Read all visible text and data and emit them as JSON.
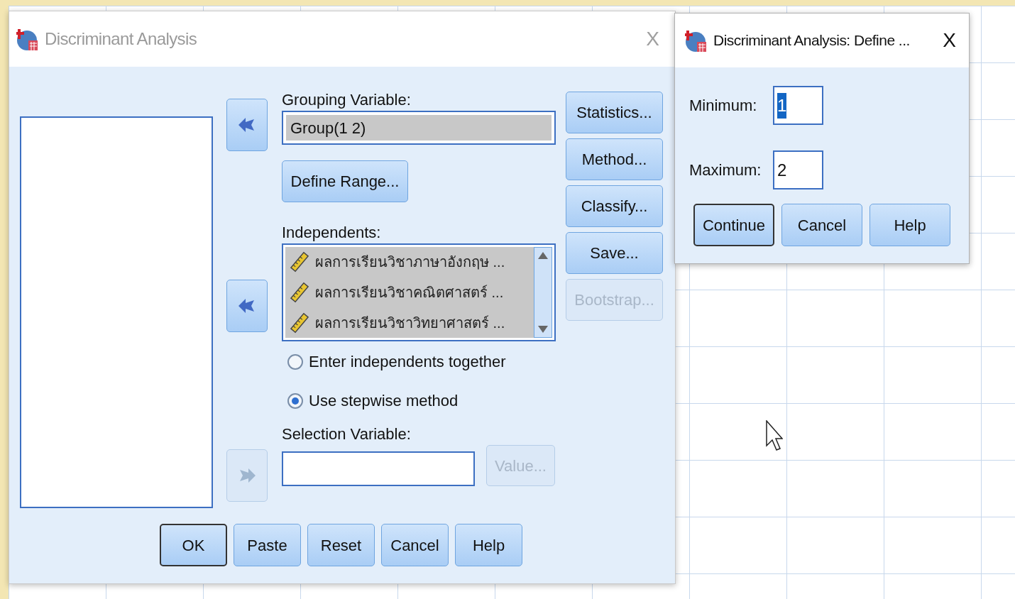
{
  "main_dialog": {
    "title": "Discriminant Analysis",
    "close": "X",
    "grouping_variable": {
      "label": "Grouping Variable:",
      "value": "Group(1 2)"
    },
    "define_range_button": {
      "label": "Define Range...",
      "disabled": false
    },
    "independents": {
      "label": "Independents:",
      "items": [
        {
          "label": "ผลการเรียนวิชาภาษาอังกฤษ ..."
        },
        {
          "label": "ผลการเรียนวิชาคณิตศาสตร์ ..."
        },
        {
          "label": "ผลการเรียนวิชาวิทยาศาสตร์ ..."
        }
      ]
    },
    "arrow_buttons": [
      {
        "kind": "left",
        "disabled": false
      },
      {
        "kind": "left",
        "disabled": false
      },
      {
        "kind": "right",
        "disabled": true
      }
    ],
    "method_options": [
      {
        "label": "Enter independents together",
        "selected": false
      },
      {
        "label": "Use stepwise method",
        "selected": true
      }
    ],
    "selection_variable": {
      "label": "Selection Variable:",
      "value_button": {
        "label": "Value...",
        "disabled": true
      }
    },
    "side_buttons": [
      {
        "label": "Statistics...",
        "disabled": false
      },
      {
        "label": "Method...",
        "disabled": false
      },
      {
        "label": "Classify...",
        "disabled": false
      },
      {
        "label": "Save...",
        "disabled": false
      },
      {
        "label": "Bootstrap...",
        "disabled": true
      }
    ],
    "bottom_buttons": [
      {
        "label": "OK",
        "default": true
      },
      {
        "label": "Paste",
        "default": false
      },
      {
        "label": "Reset",
        "default": false
      },
      {
        "label": "Cancel",
        "default": false
      },
      {
        "label": "Help",
        "default": false
      }
    ]
  },
  "define_dialog": {
    "title": "Discriminant Analysis: Define ...",
    "close": "X",
    "fields": [
      {
        "label": "Minimum:",
        "value": "1",
        "focused": true
      },
      {
        "label": "Maximum:",
        "value": "2",
        "focused": false
      }
    ],
    "buttons": [
      {
        "label": "Continue",
        "default": true
      },
      {
        "label": "Cancel",
        "default": false
      },
      {
        "label": "Help",
        "default": false
      }
    ]
  }
}
